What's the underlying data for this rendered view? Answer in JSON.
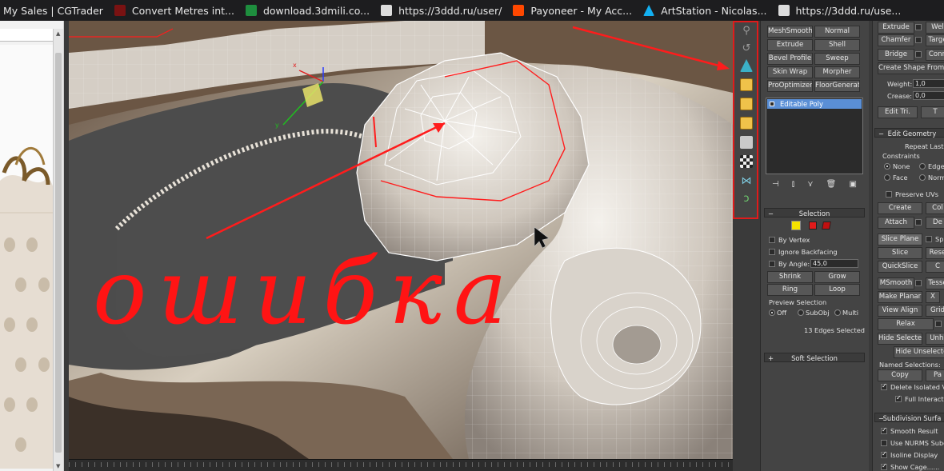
{
  "bookmarks": [
    {
      "label": "My Sales | CGTrader",
      "icon": "none"
    },
    {
      "label": "Convert Metres int...",
      "icon": "cgtrader-icon"
    },
    {
      "label": "download.3dmili.co...",
      "icon": "sheet-icon"
    },
    {
      "label": "https://3ddd.ru/user/",
      "icon": "3ddd-icon"
    },
    {
      "label": "Payoneer - My Acc...",
      "icon": "payoneer-icon"
    },
    {
      "label": "ArtStation - Nicolas...",
      "icon": "artstation-icon"
    },
    {
      "label": "https://3ddd.ru/use...",
      "icon": "3ddd-icon"
    }
  ],
  "viewport": {
    "annotation_text": "ошибка"
  },
  "vertical_toolbar": {
    "icons": [
      "pin-stack-icon",
      "make-unique-icon",
      "cone-icon",
      "cube-icon",
      "cube-icon",
      "cube-icon",
      "stack-icon",
      "checker-icon",
      "symmetry-icon",
      "configure-icon"
    ]
  },
  "modifier_list": {
    "buttons": [
      "MeshSmooth",
      "Normal",
      "Extrude",
      "Shell",
      "Bevel Profile",
      "Sweep",
      "Skin Wrap",
      "Morpher",
      "ProOptimizer",
      "FloorGenerator"
    ],
    "stack_item": "Editable Poly"
  },
  "selection": {
    "title": "Selection",
    "by_vertex": "By Vertex",
    "ignore_backfacing": "Ignore Backfacing",
    "by_angle": "By Angle:",
    "angle_value": "45,0",
    "shrink": "Shrink",
    "grow": "Grow",
    "ring": "Ring",
    "loop": "Loop",
    "preview_selection": "Preview Selection",
    "preview_off": "Off",
    "preview_subobj": "SubObj",
    "preview_multi": "Multi",
    "status": "13 Edges Selected",
    "soft_selection": "Soft Selection",
    "accent_color": "#f5e300"
  },
  "edit_poly": {
    "extrude": "Extrude",
    "weld": "Wel",
    "chamfer": "Chamfer",
    "target": "Targe",
    "bridge": "Bridge",
    "connect": "Conn",
    "create_shape": "Create Shape From Se",
    "weight_label": "Weight:",
    "weight_value": "1,0",
    "crease_label": "Crease:",
    "crease_value": "0,0",
    "edit_tri": "Edit Tri.",
    "turn": "T",
    "edit_geometry": "Edit Geometry",
    "repeat_last": "Repeat Last",
    "constraints": "Constraints",
    "c_none": "None",
    "c_edge": "Edge",
    "c_face": "Face",
    "c_normal": "Norm",
    "preserve_uvs": "Preserve UVs",
    "create": "Create",
    "collapse": "Col",
    "attach": "Attach",
    "detach": "De",
    "slice_plane": "Slice Plane",
    "split": "Spl",
    "slice": "Slice",
    "reset": "Rese",
    "quickslice": "QuickSlice",
    "cut": "C",
    "msmooth": "MSmooth",
    "tessellate": "Tesse",
    "make_planar": "Make Planar",
    "x": "X",
    "view_align": "View Align",
    "grid_align": "Grid",
    "relax": "Relax",
    "hide_selected": "Hide Selected",
    "unhide": "Unhi",
    "hide_unselected": "Hide Unselecte",
    "named_selections": "Named Selections:",
    "copy": "Copy",
    "paste": "Pa",
    "delete_isolated": "Delete Isolated Ve",
    "full_interactive": "Full Interacti",
    "subdivision_surface": "Subdivision Surfa",
    "smooth_result": "Smooth Result",
    "use_nurms": "Use NURMS Subdi",
    "isoline_display": "Isoline Display",
    "show_cage": "Show Cage......"
  }
}
